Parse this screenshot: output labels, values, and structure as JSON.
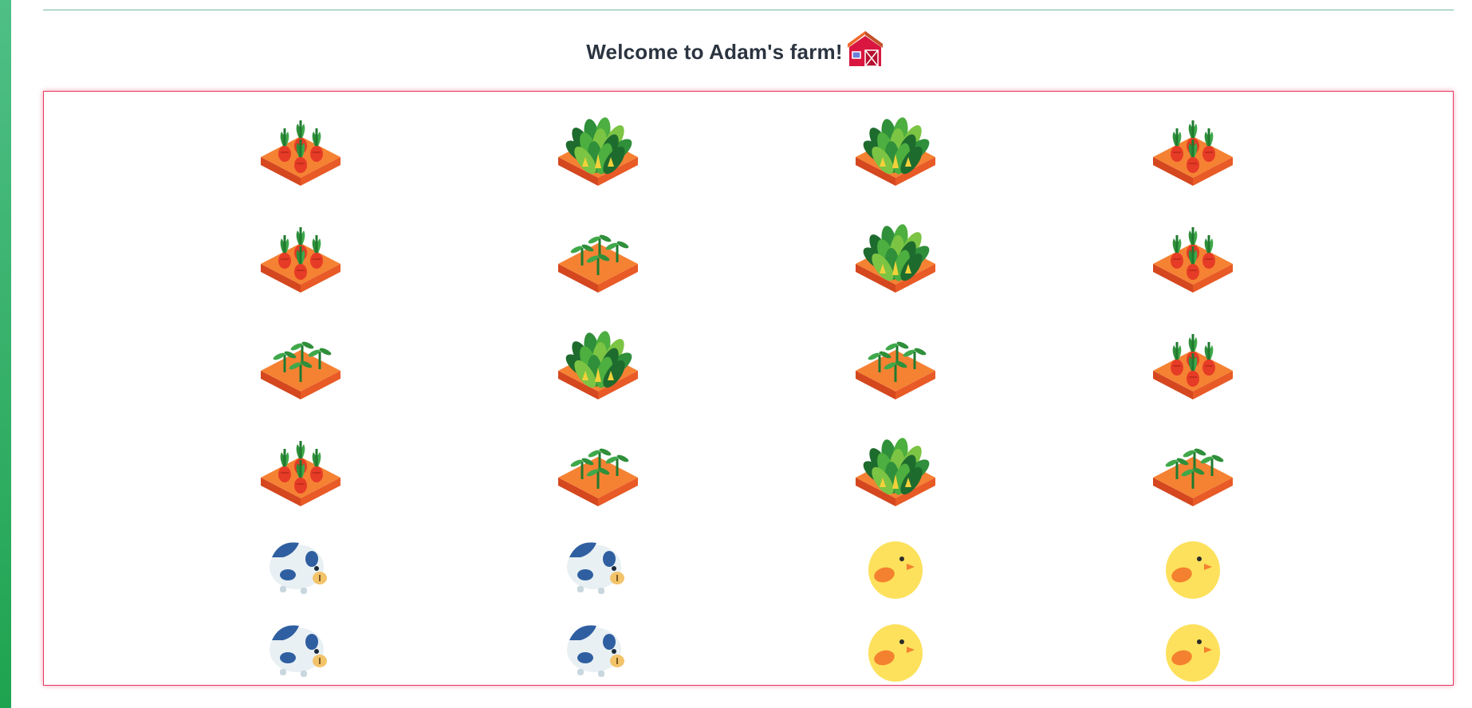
{
  "page": {
    "title": "Welcome to Adam's farm!",
    "title_icon": "barn-icon"
  },
  "colors": {
    "accent_strip": "#1fa34f",
    "grid_border": "#e6365f",
    "title_text": "#2b3440",
    "soil": "#f47a2c"
  },
  "farm": {
    "rows": [
      [
        "carrot-plot",
        "lettuce-plot",
        "lettuce-plot",
        "carrot-plot"
      ],
      [
        "carrot-plot",
        "sprout-plot",
        "lettuce-plot",
        "carrot-plot"
      ],
      [
        "sprout-plot",
        "lettuce-plot",
        "sprout-plot",
        "carrot-plot"
      ],
      [
        "carrot-plot",
        "sprout-plot",
        "lettuce-plot",
        "sprout-plot"
      ],
      [
        "cow",
        "cow",
        "chick",
        "chick"
      ],
      [
        "cow",
        "cow",
        "chick",
        "chick"
      ]
    ]
  }
}
